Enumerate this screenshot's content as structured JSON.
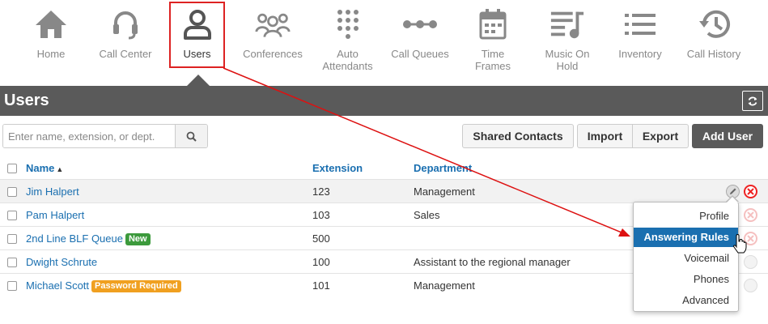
{
  "nav": {
    "items": [
      {
        "label": "Home",
        "icon": "home-icon"
      },
      {
        "label": "Call Center",
        "icon": "headset-icon"
      },
      {
        "label": "Users",
        "icon": "user-icon"
      },
      {
        "label": "Conferences",
        "icon": "group-icon"
      },
      {
        "label": "Auto\nAttendants",
        "icon": "keypad-icon"
      },
      {
        "label": "Call Queues",
        "icon": "queue-icon"
      },
      {
        "label": "Time\nFrames",
        "icon": "calendar-icon"
      },
      {
        "label": "Music On\nHold",
        "icon": "music-list-icon"
      },
      {
        "label": "Inventory",
        "icon": "list-icon"
      },
      {
        "label": "Call History",
        "icon": "history-icon"
      }
    ],
    "active": "Users"
  },
  "header": {
    "title": "Users"
  },
  "search": {
    "placeholder": "Enter name, extension, or dept.",
    "value": ""
  },
  "toolbar": {
    "shared_contacts": "Shared Contacts",
    "import": "Import",
    "export": "Export",
    "add_user": "Add User"
  },
  "table": {
    "columns": {
      "name": "Name",
      "extension": "Extension",
      "department": "Department"
    },
    "sort_indicator": "▲",
    "rows": [
      {
        "name": "Jim Halpert",
        "badge": "",
        "extension": "123",
        "department": "Management"
      },
      {
        "name": "Pam Halpert",
        "badge": "",
        "extension": "103",
        "department": "Sales"
      },
      {
        "name": "2nd Line BLF Queue",
        "badge": "New",
        "extension": "500",
        "department": ""
      },
      {
        "name": "Dwight Schrute",
        "badge": "",
        "extension": "100",
        "department": "Assistant to the regional manager"
      },
      {
        "name": "Michael Scott",
        "badge": "Password Required",
        "extension": "101",
        "department": "Management"
      }
    ]
  },
  "dropdown": {
    "items": [
      "Profile",
      "Answering Rules",
      "Voicemail",
      "Phones",
      "Advanced"
    ],
    "active": "Answering Rules"
  },
  "colors": {
    "accent": "#1a6fb0",
    "header_bg": "#5a5a5a",
    "highlight_frame": "#dd2222",
    "badge_new": "#3c9a3c",
    "badge_password": "#f0a020"
  }
}
